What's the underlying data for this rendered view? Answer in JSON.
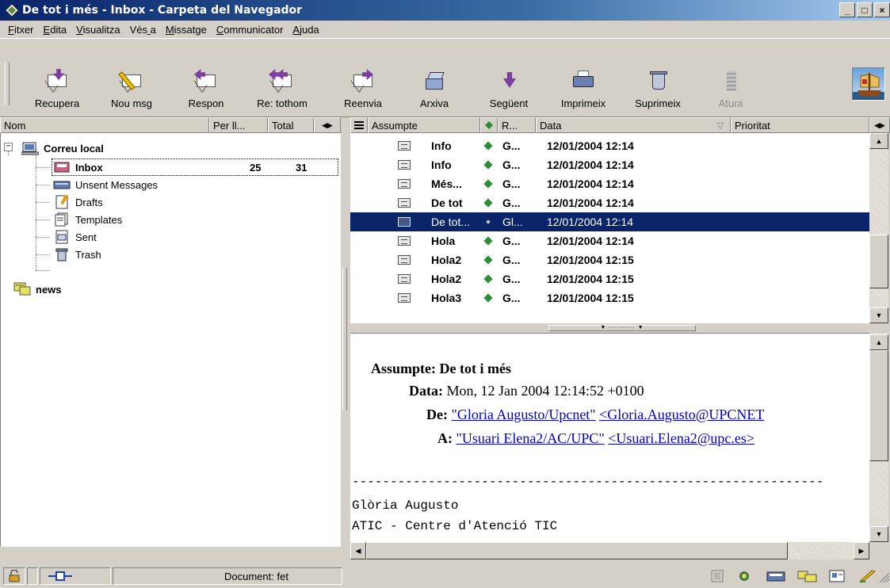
{
  "window": {
    "title": "De tot i més - Inbox - Carpeta del Navegador",
    "controls": [
      "_",
      "□",
      "×"
    ]
  },
  "menu": [
    {
      "label": "Fitxer"
    },
    {
      "label": "Edita"
    },
    {
      "label": "Visualitza"
    },
    {
      "label": "Vés a"
    },
    {
      "label": "Missatge"
    },
    {
      "label": "Communicator"
    },
    {
      "label": "Ajuda"
    }
  ],
  "toolbar": {
    "buttons": [
      {
        "label": "Recupera",
        "icon": "get-mail-icon"
      },
      {
        "label": "Nou msg",
        "icon": "new-message-icon"
      },
      {
        "label": "Respon",
        "icon": "reply-icon"
      },
      {
        "label": "Re: tothom",
        "icon": "reply-all-icon"
      },
      {
        "label": "Reenvia",
        "icon": "forward-icon"
      },
      {
        "label": "Arxiva",
        "icon": "file-icon"
      },
      {
        "label": "Següent",
        "icon": "next-icon"
      },
      {
        "label": "Imprimeix",
        "icon": "print-icon"
      },
      {
        "label": "Suprimeix",
        "icon": "delete-icon"
      },
      {
        "label": "Atura",
        "icon": "stop-icon",
        "disabled": true
      }
    ]
  },
  "folder_pane": {
    "columns": [
      "Nom",
      "Per ll...",
      "Total"
    ],
    "items": [
      {
        "name": "Correu local",
        "icon": "local-mail-icon",
        "bold": true
      },
      {
        "name": "Inbox",
        "icon": "inbox-icon",
        "unread": "25",
        "total": "31",
        "bold": true
      },
      {
        "name": "Unsent Messages",
        "icon": "unsent-icon"
      },
      {
        "name": "Drafts",
        "icon": "drafts-icon"
      },
      {
        "name": "Templates",
        "icon": "templates-icon"
      },
      {
        "name": "Sent",
        "icon": "sent-icon"
      },
      {
        "name": "Trash",
        "icon": "trash-icon"
      },
      {
        "name": "news",
        "icon": "news-icon",
        "bold": true
      }
    ]
  },
  "message_list": {
    "columns": [
      "Assumpte",
      "R...",
      "Data",
      "Prioritat"
    ],
    "rows": [
      {
        "subject": "Info",
        "sender": "G...",
        "date": "12/01/2004 12:14",
        "unread": true
      },
      {
        "subject": "Info",
        "sender": "G...",
        "date": "12/01/2004 12:14",
        "unread": true
      },
      {
        "subject": "Més...",
        "sender": "G...",
        "date": "12/01/2004 12:14",
        "unread": true
      },
      {
        "subject": "De tot",
        "sender": "G...",
        "date": "12/01/2004 12:14",
        "unread": true
      },
      {
        "subject": "De tot...",
        "sender": "Gl...",
        "date": "12/01/2004 12:14",
        "selected": true
      },
      {
        "subject": "Hola",
        "sender": "G...",
        "date": "12/01/2004 12:14",
        "unread": true
      },
      {
        "subject": "Hola2",
        "sender": "G...",
        "date": "12/01/2004 12:15",
        "unread": true
      },
      {
        "subject": "Hola2",
        "sender": "G...",
        "date": "12/01/2004 12:15",
        "unread": true
      },
      {
        "subject": "Hola3",
        "sender": "G...",
        "date": "12/01/2004 12:15",
        "unread": true
      }
    ]
  },
  "preview": {
    "subject_label": "Assumpte:",
    "subject": "De tot i més",
    "date_label": "Data:",
    "date": "Mon, 12 Jan 2004 12:14:52 +0100",
    "from_label": "De:",
    "from_name": "\"Gloria Augusto/Upcnet\"",
    "from_email": "<Gloria.Augusto@UPCNET",
    "to_label": "A:",
    "to_name": "\"Usuari Elena2/AC/UPC\"",
    "to_email": "<Usuari.Elena2@upc.es>",
    "separator": "--------------------------------------------------------------",
    "body": [
      "Glòria Augusto",
      "ATIC - Centre d'Atenció TIC"
    ]
  },
  "status": {
    "text": "Document: fet"
  },
  "colors": {
    "title_active": "#0a246a",
    "selection": "#0a246a",
    "link": "#0000cc",
    "read_diamond": "#2e8b3a"
  }
}
